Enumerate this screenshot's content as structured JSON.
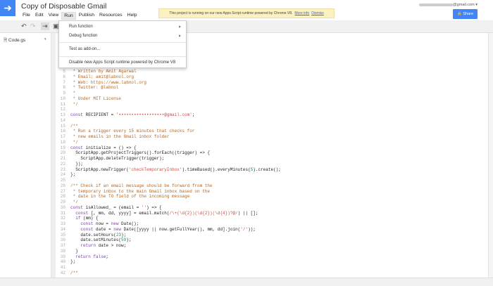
{
  "header": {
    "title": "Copy of Disposable Gmail",
    "logo_icon": "arrow-right-icon",
    "menus": [
      "File",
      "Edit",
      "View",
      "Run",
      "Publish",
      "Resources",
      "Help"
    ],
    "active_menu": "Run"
  },
  "banner": {
    "text": "This project is running on our new Apps Script runtime powered by Chrome V8.",
    "more_info": "More info",
    "dismiss": "Dismiss"
  },
  "account": {
    "email_suffix": "@gmail.com"
  },
  "share": {
    "label": "Share"
  },
  "sidebar": {
    "file": "Code.gs"
  },
  "run_menu": {
    "items": [
      "Run function",
      "Debug function",
      "Test as add-on...",
      "Disable new Apps Script runtime powered by Chrome V8"
    ]
  },
  "code": {
    "start": 5,
    "lines": [
      [
        [
          " * Written by Amit Agarwal",
          "c"
        ]
      ],
      [
        [
          " * Email: amit@labnol.org",
          "c"
        ]
      ],
      [
        [
          " * Web: https://www.labnol.org",
          "c"
        ]
      ],
      [
        [
          " * Twitter: @labnol",
          "c"
        ]
      ],
      [
        [
          " *",
          "c"
        ]
      ],
      [
        [
          " * Under MIT License",
          "c"
        ]
      ],
      [
        [
          " */",
          "c"
        ]
      ],
      [],
      [
        [
          "const",
          "k"
        ],
        [
          " RECIPIENT = ",
          "p"
        ],
        [
          "'••••••••••••••••••@gmail.com'",
          "s"
        ],
        [
          ";",
          "p"
        ]
      ],
      [],
      [
        [
          "/**",
          "c"
        ]
      ],
      [
        [
          " * Run a trigger every 15 minutes that checks for",
          "c"
        ]
      ],
      [
        [
          " * new emails in the Gmail inbox folder",
          "c"
        ]
      ],
      [
        [
          " */",
          "c"
        ]
      ],
      [
        [
          "const",
          "k"
        ],
        [
          " initialize = () => {",
          "p"
        ]
      ],
      [
        [
          "  ScriptApp.getProjectTriggers().forEach((trigger) => {",
          "p"
        ]
      ],
      [
        [
          "    ScriptApp.deleteTrigger(trigger);",
          "p"
        ]
      ],
      [
        [
          "  });",
          "p"
        ]
      ],
      [
        [
          "  ScriptApp.newTrigger(",
          "p"
        ],
        [
          "'checkTemporaryInbox'",
          "s"
        ],
        [
          ").timeBased().everyMinutes(",
          "p"
        ],
        [
          "5",
          "n"
        ],
        [
          ").create();",
          "p"
        ]
      ],
      [
        [
          "};",
          "p"
        ]
      ],
      [],
      [
        [
          "/** Check if an email message should be forward from the",
          "c"
        ]
      ],
      [
        [
          " * temporary inbox to the main Gmail inbox based on the",
          "c"
        ]
      ],
      [
        [
          " * date in the TO field of the incoming message",
          "c"
        ]
      ],
      [
        [
          " */",
          "c"
        ]
      ],
      [
        [
          "const",
          "k"
        ],
        [
          " isAllowed_ = (email = ",
          "p"
        ],
        [
          "''",
          "s"
        ],
        [
          ") => {",
          "p"
        ]
      ],
      [
        [
          "  const",
          "k"
        ],
        [
          " [, mm, dd, yyyy] = email.match(",
          "p"
        ],
        [
          "/\\+(\\d{2})(\\d{2})(\\d{4})?@/",
          "s"
        ],
        [
          ") || [];",
          "p"
        ]
      ],
      [
        [
          "  if",
          "k"
        ],
        [
          " (mm) {",
          "p"
        ]
      ],
      [
        [
          "    const",
          "k"
        ],
        [
          " now = ",
          "p"
        ],
        [
          "new",
          "k"
        ],
        [
          " Date();",
          "p"
        ]
      ],
      [
        [
          "    const",
          "k"
        ],
        [
          " date = ",
          "p"
        ],
        [
          "new",
          "k"
        ],
        [
          " Date([yyyy || now.getFullYear(), mm, dd].join(",
          "p"
        ],
        [
          "'/'",
          "s"
        ],
        [
          "));",
          "p"
        ]
      ],
      [
        [
          "    date.setHours(",
          "p"
        ],
        [
          "23",
          "n"
        ],
        [
          ");",
          "p"
        ]
      ],
      [
        [
          "    date.setMinutes(",
          "p"
        ],
        [
          "59",
          "n"
        ],
        [
          ");",
          "p"
        ]
      ],
      [
        [
          "    return",
          "k"
        ],
        [
          " date > now;",
          "p"
        ]
      ],
      [
        [
          "  }",
          "p"
        ]
      ],
      [
        [
          "  return false",
          "k"
        ],
        [
          ";",
          "p"
        ]
      ],
      [
        [
          "};",
          "p"
        ]
      ],
      [],
      [
        [
          "/**",
          "c"
        ]
      ]
    ]
  }
}
